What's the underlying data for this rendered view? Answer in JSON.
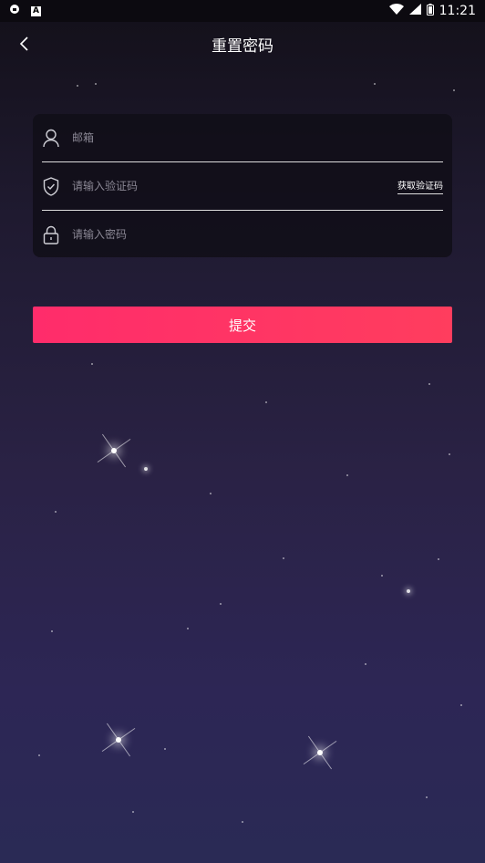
{
  "status_bar": {
    "time": "11:21",
    "icons": [
      "shield-status-icon",
      "a-badge-icon",
      "wifi-icon",
      "signal-icon",
      "battery-icon"
    ]
  },
  "header": {
    "title": "重置密码",
    "back_icon": "chevron-left-icon"
  },
  "form": {
    "email": {
      "placeholder": "邮箱",
      "value": "",
      "icon": "user-icon"
    },
    "code": {
      "placeholder": "请输入验证码",
      "value": "",
      "icon": "shield-check-icon",
      "action_label": "获取验证码"
    },
    "password": {
      "placeholder": "请输入密码",
      "value": "",
      "icon": "lock-icon"
    }
  },
  "submit_label": "提交",
  "colors": {
    "accent": "#ff3366",
    "card_bg": "#100e18",
    "background_top": "#131019",
    "background_bottom": "#2a2a55"
  }
}
